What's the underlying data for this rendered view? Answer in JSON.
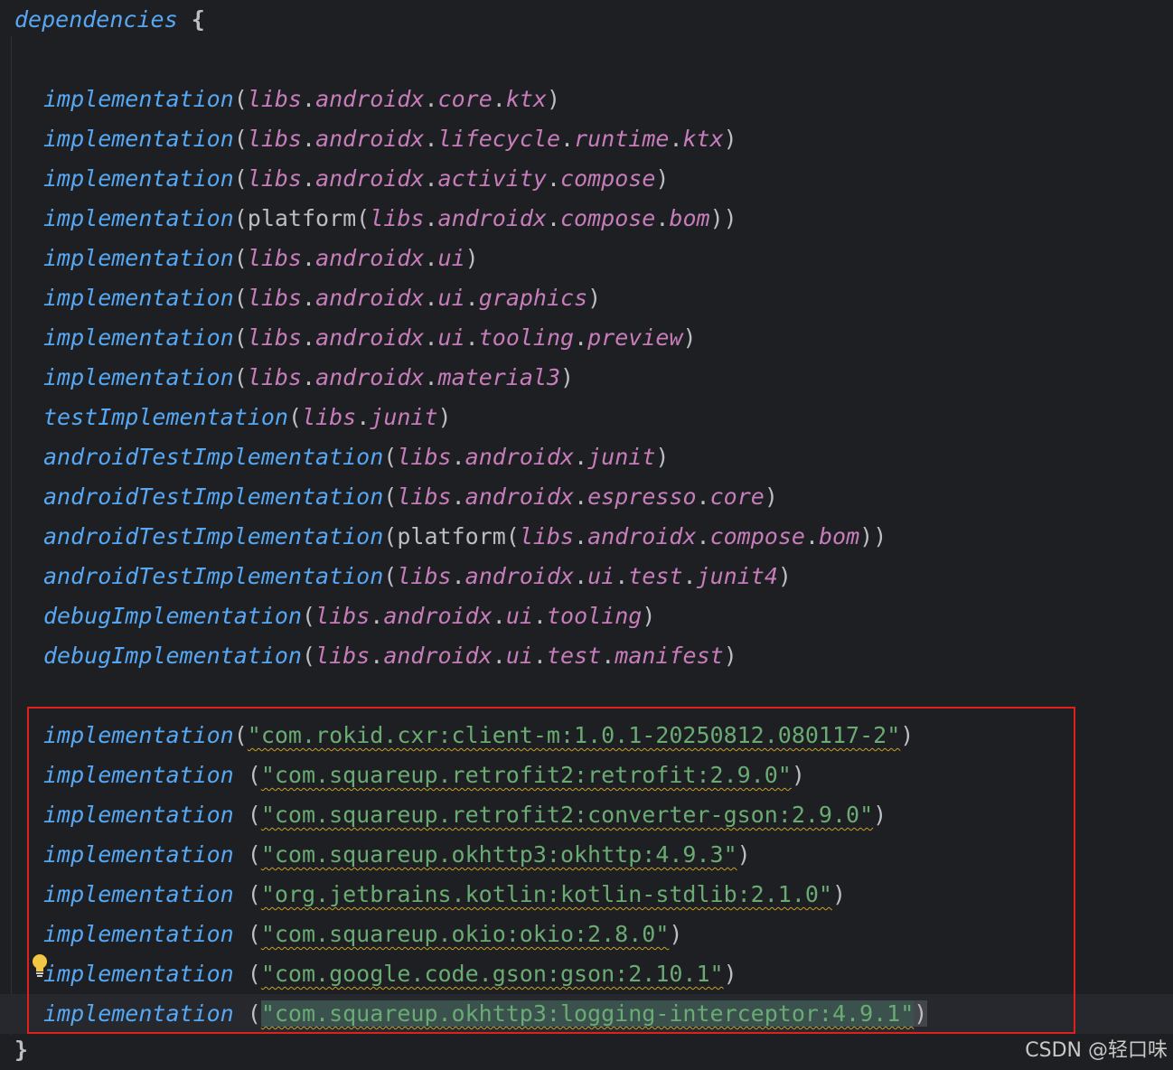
{
  "editor": {
    "opening": {
      "keyword": "dependencies",
      "brace": "{"
    },
    "closing_brace": "}",
    "lines": [
      {
        "call": "implementation",
        "paren": "(",
        "parts": [
          "libs",
          ".",
          "androidx",
          ".",
          "core",
          ".",
          "ktx"
        ],
        "close": ")"
      },
      {
        "call": "implementation",
        "paren": "(",
        "parts": [
          "libs",
          ".",
          "androidx",
          ".",
          "lifecycle",
          ".",
          "runtime",
          ".",
          "ktx"
        ],
        "close": ")"
      },
      {
        "call": "implementation",
        "paren": "(",
        "parts": [
          "libs",
          ".",
          "androidx",
          ".",
          "activity",
          ".",
          "compose"
        ],
        "close": ")"
      },
      {
        "call": "implementation",
        "paren": "(platform(",
        "parts": [
          "libs",
          ".",
          "androidx",
          ".",
          "compose",
          ".",
          "bom"
        ],
        "close": "))"
      },
      {
        "call": "implementation",
        "paren": "(",
        "parts": [
          "libs",
          ".",
          "androidx",
          ".",
          "ui"
        ],
        "close": ")"
      },
      {
        "call": "implementation",
        "paren": "(",
        "parts": [
          "libs",
          ".",
          "androidx",
          ".",
          "ui",
          ".",
          "graphics"
        ],
        "close": ")"
      },
      {
        "call": "implementation",
        "paren": "(",
        "parts": [
          "libs",
          ".",
          "androidx",
          ".",
          "ui",
          ".",
          "tooling",
          ".",
          "preview"
        ],
        "close": ")"
      },
      {
        "call": "implementation",
        "paren": "(",
        "parts": [
          "libs",
          ".",
          "androidx",
          ".",
          "material3"
        ],
        "close": ")"
      },
      {
        "call": "testImplementation",
        "paren": "(",
        "parts": [
          "libs",
          ".",
          "junit"
        ],
        "close": ")"
      },
      {
        "call": "androidTestImplementation",
        "paren": "(",
        "parts": [
          "libs",
          ".",
          "androidx",
          ".",
          "junit"
        ],
        "close": ")"
      },
      {
        "call": "androidTestImplementation",
        "paren": "(",
        "parts": [
          "libs",
          ".",
          "androidx",
          ".",
          "espresso",
          ".",
          "core"
        ],
        "close": ")"
      },
      {
        "call": "androidTestImplementation",
        "paren": "(platform(",
        "parts": [
          "libs",
          ".",
          "androidx",
          ".",
          "compose",
          ".",
          "bom"
        ],
        "close": "))"
      },
      {
        "call": "androidTestImplementation",
        "paren": "(",
        "parts": [
          "libs",
          ".",
          "androidx",
          ".",
          "ui",
          ".",
          "test",
          ".",
          "junit4"
        ],
        "close": ")"
      },
      {
        "call": "debugImplementation",
        "paren": "(",
        "parts": [
          "libs",
          ".",
          "androidx",
          ".",
          "ui",
          ".",
          "tooling"
        ],
        "close": ")"
      },
      {
        "call": "debugImplementation",
        "paren": "(",
        "parts": [
          "libs",
          ".",
          "androidx",
          ".",
          "ui",
          ".",
          "test",
          ".",
          "manifest"
        ],
        "close": ")"
      }
    ],
    "string_lines": [
      {
        "call": "implementation",
        "open": "(",
        "value": "\"com.rokid.cxr:client-m:1.0.1-20250812.080117-2\"",
        "close": ")"
      },
      {
        "call": "implementation",
        "open": " (",
        "value": "\"com.squareup.retrofit2:retrofit:2.9.0\"",
        "close": ")"
      },
      {
        "call": "implementation",
        "open": " (",
        "value": "\"com.squareup.retrofit2:converter-gson:2.9.0\"",
        "close": ")"
      },
      {
        "call": "implementation",
        "open": " (",
        "value": "\"com.squareup.okhttp3:okhttp:4.9.3\"",
        "close": ")"
      },
      {
        "call": "implementation",
        "open": " (",
        "value": "\"org.jetbrains.kotlin:kotlin-stdlib:2.1.0\"",
        "close": ")"
      },
      {
        "call": "implementation",
        "open": " (",
        "value": "\"com.squareup.okio:okio:2.8.0\"",
        "close": ")"
      },
      {
        "call": "implementation",
        "open": " (",
        "value": "\"com.google.code.gson:gson:2.10.1\"",
        "close": ")"
      },
      {
        "call": "implementation",
        "open": " (",
        "value": "\"com.squareup.okhttp3:logging-interceptor:4.9.1\"",
        "close": ")"
      }
    ]
  },
  "watermark": "CSDN @轻口味",
  "colors": {
    "background": "#1e1f22",
    "function_call": "#56a8f5",
    "property": "#c77dbb",
    "string": "#6aab73",
    "highlight_box": "#e0201b",
    "warning_underline": "#c9a227"
  }
}
